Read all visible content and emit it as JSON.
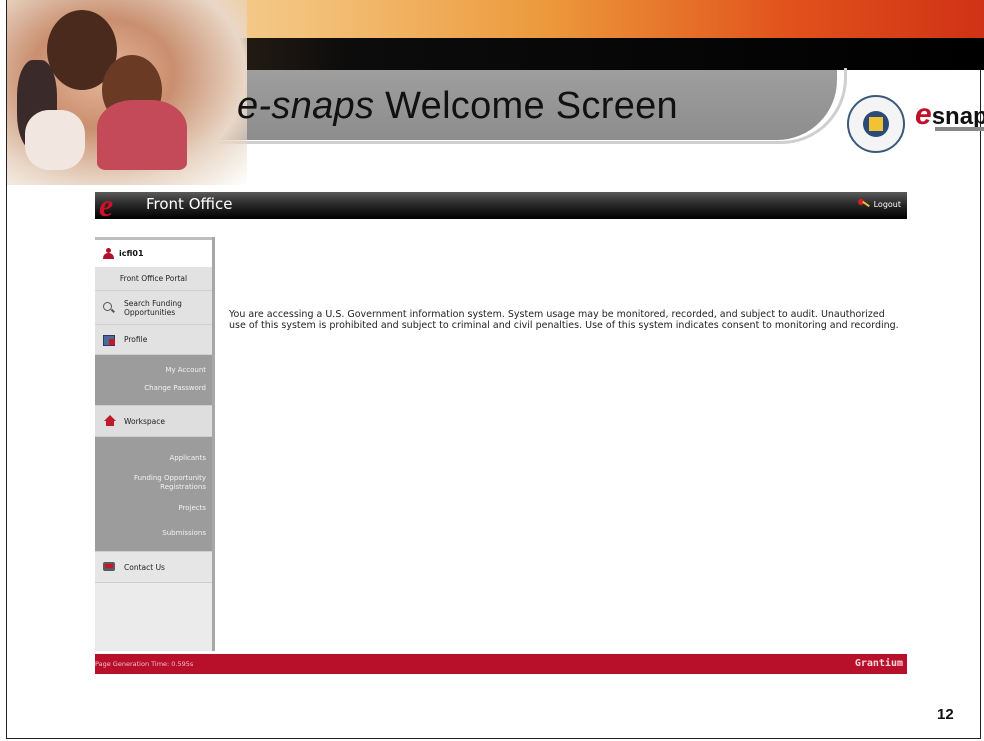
{
  "slide": {
    "title_prefix": "e-snaps",
    "title_suffix": " Welcome Screen",
    "page_number": "12",
    "logo_text": "snaps",
    "logo_mark": "e"
  },
  "app": {
    "logo_letter": "e",
    "title": "Front Office",
    "logout_label": "Logout"
  },
  "sidebar": {
    "username": "icfi01",
    "front_office_portal": "Front Office Portal",
    "search_funding": "Search Funding Opportunities",
    "profile": "Profile",
    "my_account": "My Account",
    "change_password": "Change Password",
    "workspace": "Workspace",
    "applicants": "Applicants",
    "funding_opportunity_registrations": "Funding Opportunity Registrations",
    "projects": "Projects",
    "submissions": "Submissions",
    "contact_us": "Contact Us"
  },
  "main": {
    "notice": "You are accessing a U.S. Government information system. System usage may be monitored, recorded, and subject to audit. Unauthorized use of this system is prohibited and subject to criminal and civil penalties. Use of this system indicates consent to monitoring and recording."
  },
  "footer": {
    "generation_time": "Page Generation Time: 0.595s",
    "brand": "Grantium"
  },
  "colors": {
    "accent_red": "#b8102a",
    "header_black": "#000000",
    "sidebar_gray": "#9c9c9c"
  },
  "icons": [
    "user-icon",
    "search-icon",
    "profile-icon",
    "home-icon",
    "mail-icon",
    "key-icon",
    "hud-seal-icon"
  ]
}
